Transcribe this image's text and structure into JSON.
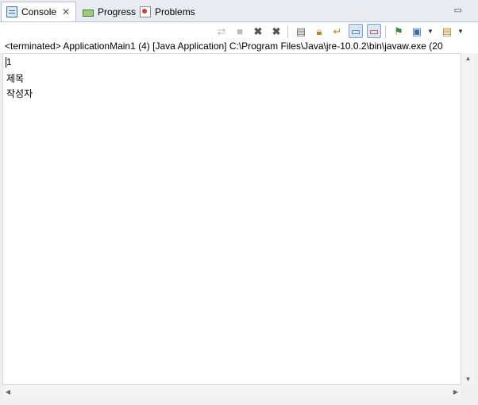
{
  "tabs": [
    {
      "label": "Console",
      "active": true,
      "icon": "console-icon"
    },
    {
      "label": "Progress",
      "active": false,
      "icon": "progress-icon"
    },
    {
      "label": "Problems",
      "active": false,
      "icon": "problems-icon"
    }
  ],
  "tab_close_glyph": "✕",
  "toolbar": {
    "buttons": [
      "pin-console-icon",
      "terminate-icon",
      "remove-launch-icon",
      "remove-all-terminated-icon",
      "clear-console-icon",
      "scroll-lock-icon",
      "word-wrap-icon",
      "show-on-stdout-icon",
      "show-on-stderr-icon",
      "pin-icon",
      "display-selected-console-icon",
      "open-console-icon"
    ]
  },
  "status_line": "<terminated> ApplicationMain1 (4) [Java Application] C:\\Program Files\\Java\\jre-10.0.2\\bin\\javaw.exe (20",
  "console_lines": [
    "1",
    "제목",
    "작성자"
  ],
  "colors": {
    "tab_bar": "#e8ecf2",
    "selected_button": "#dbe6f4"
  }
}
